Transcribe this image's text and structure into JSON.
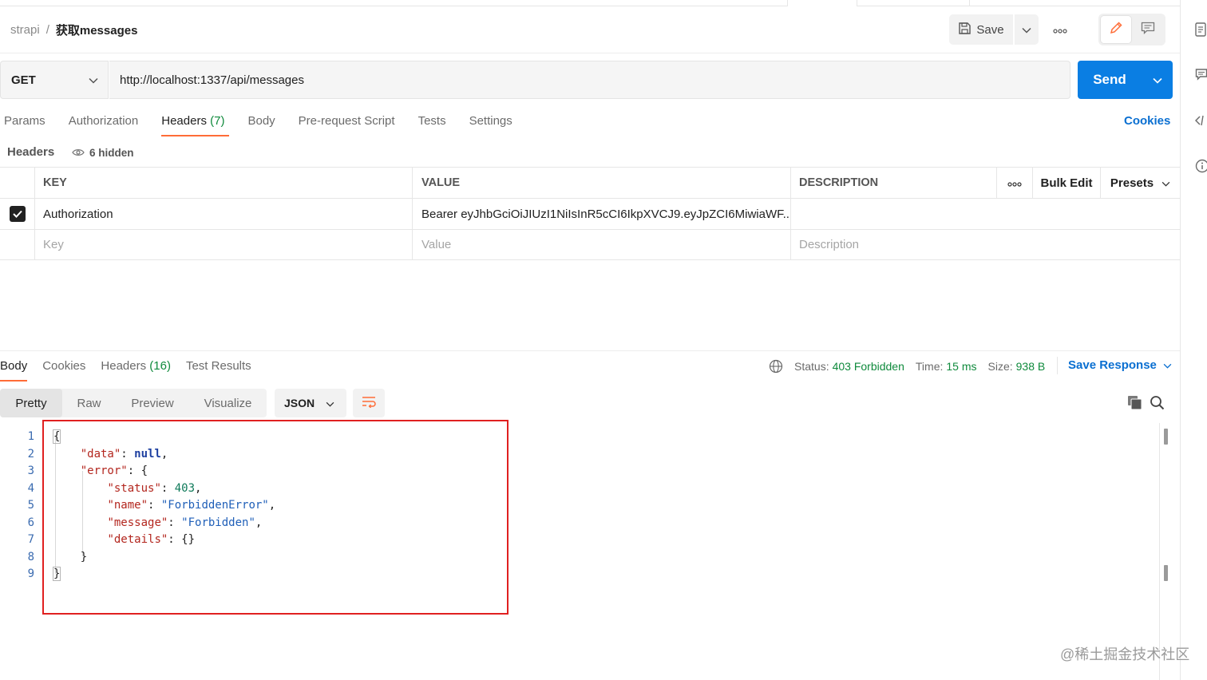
{
  "breadcrumb": {
    "parent": "strapi",
    "separator": "/",
    "current": "获取messages"
  },
  "toolbar": {
    "save_label": "Save"
  },
  "request": {
    "method": "GET",
    "url": "http://localhost:1337/api/messages",
    "send_label": "Send"
  },
  "request_tabs": {
    "params": "Params",
    "authorization": "Authorization",
    "headers": "Headers",
    "headers_count": "(7)",
    "body": "Body",
    "pre_request": "Pre-request Script",
    "tests": "Tests",
    "settings": "Settings",
    "cookies": "Cookies"
  },
  "headers_section": {
    "title": "Headers",
    "hidden_label": "6 hidden"
  },
  "headers_table": {
    "columns": {
      "key": "KEY",
      "value": "VALUE",
      "description": "DESCRIPTION",
      "bulk_edit": "Bulk Edit",
      "presets": "Presets"
    },
    "rows": [
      {
        "checked": true,
        "key": "Authorization",
        "value": "Bearer eyJhbGciOiJIUzI1NiIsInR5cCI6IkpXVCJ9.eyJpZCI6MiwiaWF...",
        "description": ""
      }
    ],
    "placeholders": {
      "key": "Key",
      "value": "Value",
      "description": "Description"
    }
  },
  "response_tabs": {
    "body": "Body",
    "cookies": "Cookies",
    "headers": "Headers",
    "headers_count": "(16)",
    "test_results": "Test Results"
  },
  "response_meta": {
    "status_label": "Status:",
    "status_value": "403 Forbidden",
    "time_label": "Time:",
    "time_value": "15 ms",
    "size_label": "Size:",
    "size_value": "938 B",
    "save_response": "Save Response",
    "status_color": "#0f8a3c"
  },
  "response_view": {
    "formats": [
      "Pretty",
      "Raw",
      "Preview",
      "Visualize"
    ],
    "active_format": "Pretty",
    "language": "JSON"
  },
  "code_lines": [
    "{",
    "    \"data\": null,",
    "    \"error\": {",
    "        \"status\": 403,",
    "        \"name\": \"ForbiddenError\",",
    "        \"message\": \"Forbidden\",",
    "        \"details\": {}",
    "    }",
    "}"
  ],
  "line_numbers": [
    "1",
    "2",
    "3",
    "4",
    "5",
    "6",
    "7",
    "8",
    "9"
  ],
  "watermark": "@稀土掘金技术社区",
  "colors": {
    "accent": "#ff6c37",
    "send": "#0a7ee3",
    "link": "#0a6fd1",
    "highlight_box": "#e02020"
  },
  "icons": [
    "save-icon",
    "chevron-down-icon",
    "more-icon",
    "edit-icon",
    "comment-icon",
    "eye-icon",
    "check-icon",
    "globe-icon",
    "wrap-icon",
    "copy-icon",
    "search-icon",
    "document-icon",
    "code-icon",
    "info-icon"
  ]
}
